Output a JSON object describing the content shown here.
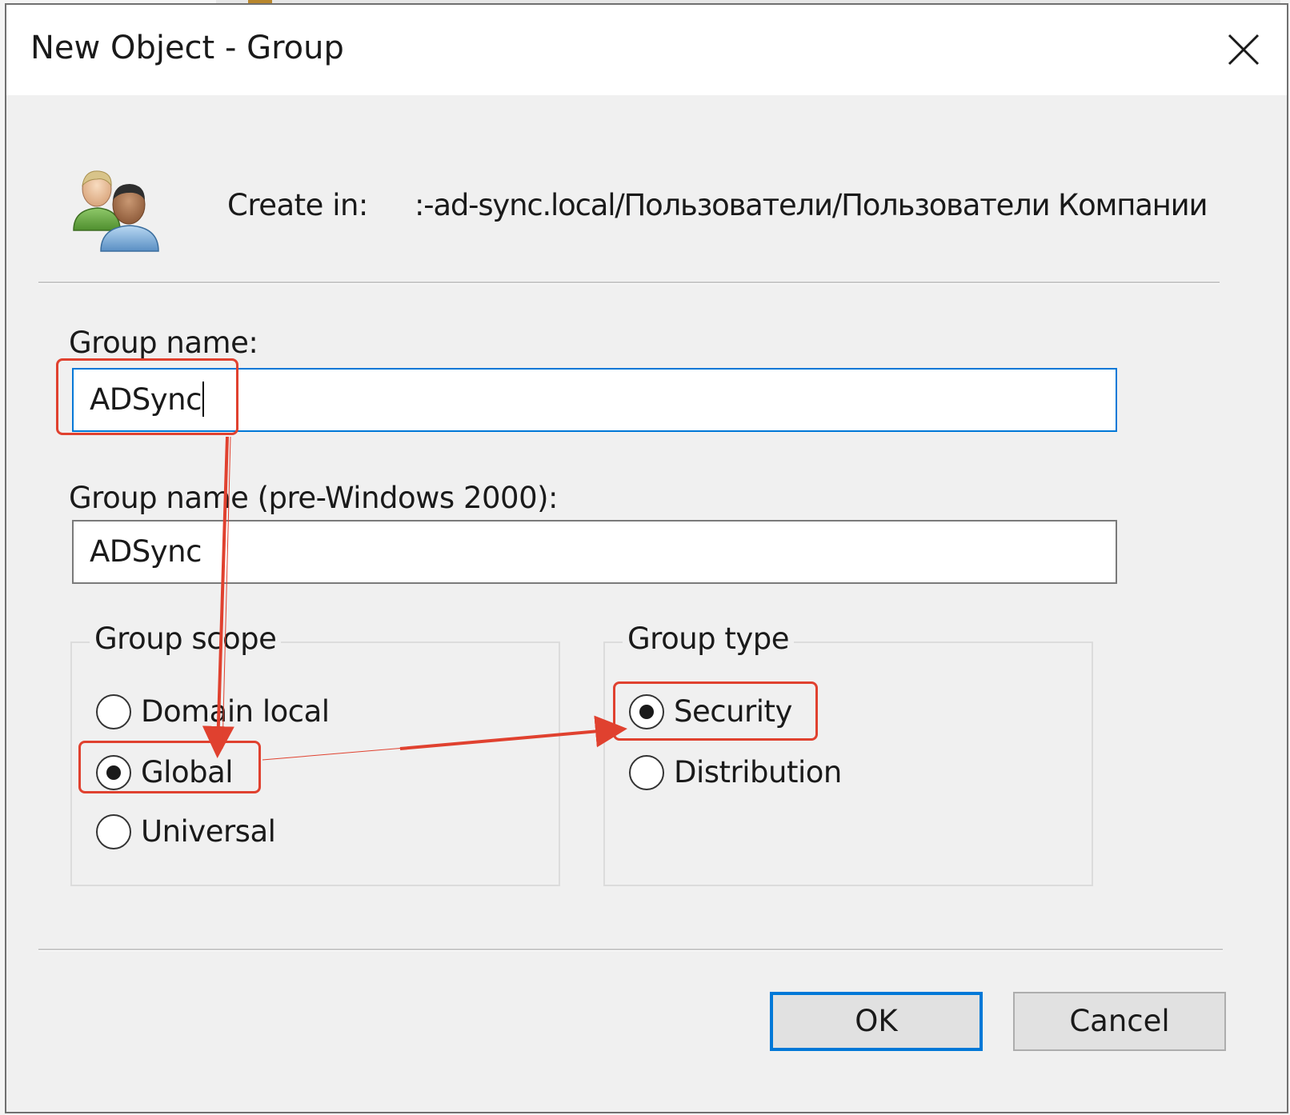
{
  "window": {
    "title": "New Object - Group",
    "close_label": "Close"
  },
  "header": {
    "icon": "users-group-icon",
    "create_in_label": "Create in:",
    "create_in_path": ":-ad-sync.local/Пользователи/Пользователи Компании"
  },
  "form": {
    "group_name_label": "Group name:",
    "group_name_value": "ADSync",
    "pre2000_label": "Group name (pre-Windows 2000):",
    "pre2000_value": "ADSync"
  },
  "group_scope": {
    "legend": "Group scope",
    "options": [
      {
        "label": "Domain local",
        "selected": false
      },
      {
        "label": "Global",
        "selected": true
      },
      {
        "label": "Universal",
        "selected": false
      }
    ]
  },
  "group_type": {
    "legend": "Group type",
    "options": [
      {
        "label": "Security",
        "selected": true
      },
      {
        "label": "Distribution",
        "selected": false
      }
    ]
  },
  "buttons": {
    "ok_label": "OK",
    "cancel_label": "Cancel"
  },
  "colors": {
    "accent": "#0078d7",
    "annotation": "#e0412f",
    "dialog_bg": "#f0f0f0"
  }
}
